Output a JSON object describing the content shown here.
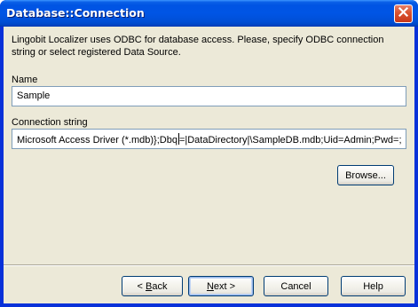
{
  "window": {
    "title": "Database::Connection",
    "close_icon": "close-icon"
  },
  "description": "Lingobit Localizer uses ODBC for database access. Please, specify ODBC connection string or select registered Data Source.",
  "name_field": {
    "label": "Name",
    "value": "Sample"
  },
  "connection_field": {
    "label": "Connection string",
    "value_before_caret": "Microsoft Access Driver (*.mdb)};Dbq",
    "value_after_caret": "=|DataDirectory|\\SampleDB.mdb;Uid=Admin;Pwd=;"
  },
  "buttons": {
    "browse": "Browse...",
    "back_prefix": "< ",
    "back_mnemonic": "B",
    "back_rest": "ack",
    "next_mnemonic": "N",
    "next_rest": "ext >",
    "cancel": "Cancel",
    "help": "Help"
  },
  "colors": {
    "titlebar": "#0054e3",
    "dialog_background": "#ece9d8",
    "close_button": "#d9532f"
  }
}
